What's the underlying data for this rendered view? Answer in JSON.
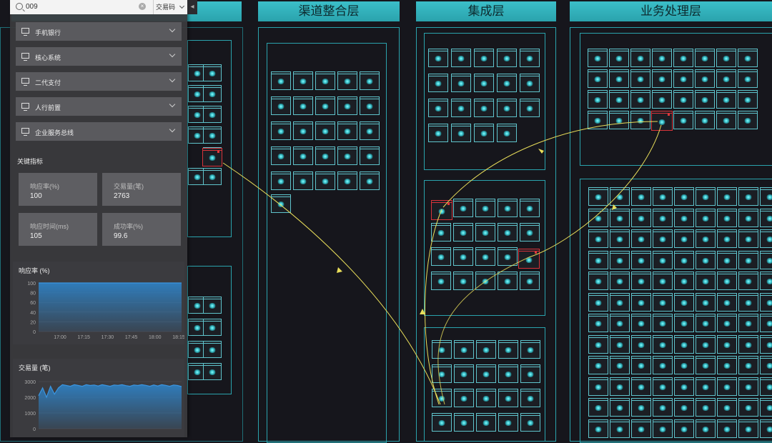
{
  "layers": {
    "left_header": "",
    "channel": "渠道整合层",
    "integration": "集成层",
    "business": "业务处理层"
  },
  "search": {
    "value": "009",
    "clear_icon": "×",
    "type_select": "交易码"
  },
  "systems": [
    "手机银行",
    "核心系统",
    "二代支付",
    "人行前置",
    "企业服务总线"
  ],
  "kpi": {
    "title": "关键指标",
    "items": [
      {
        "label": "响应率(%)",
        "value": "100"
      },
      {
        "label": "交易量(笔)",
        "value": "2763"
      },
      {
        "label": "响应时间(ms)",
        "value": "105"
      },
      {
        "label": "成功率(%)",
        "value": "99.6"
      }
    ]
  },
  "response_chart": {
    "title": "响应率 (%)",
    "chart_data": {
      "type": "area",
      "y_ticks": [
        "100",
        "80",
        "60",
        "40",
        "20",
        "0"
      ],
      "x_ticks": [
        "17:00",
        "17:15",
        "17:30",
        "17:45",
        "18:00",
        "18:15"
      ],
      "ylim": [
        0,
        100
      ],
      "values": [
        100,
        100,
        100,
        100,
        100,
        100,
        100,
        100,
        100,
        100,
        100,
        100
      ]
    }
  },
  "volume_chart": {
    "title": "交易量 (笔)",
    "chart_data": {
      "type": "area",
      "y_ticks": [
        "3000",
        "2000",
        "1000",
        "0"
      ],
      "ylim": [
        0,
        3000
      ],
      "values": [
        2100,
        2600,
        2000,
        2700,
        2200,
        2600,
        2800,
        2750,
        2700,
        2800,
        2750,
        2700,
        2800,
        2750,
        2780,
        2720,
        2800,
        2750,
        2700,
        2780,
        2760,
        2800,
        2740,
        2700,
        2780,
        2750,
        2800,
        2760,
        2700,
        2780,
        2720,
        2800,
        2760,
        2700,
        2780,
        2750,
        2680
      ]
    }
  },
  "colors": {
    "accent": "#3bbfc9",
    "alert": "#d8333a",
    "link": "#e8dd5a"
  }
}
